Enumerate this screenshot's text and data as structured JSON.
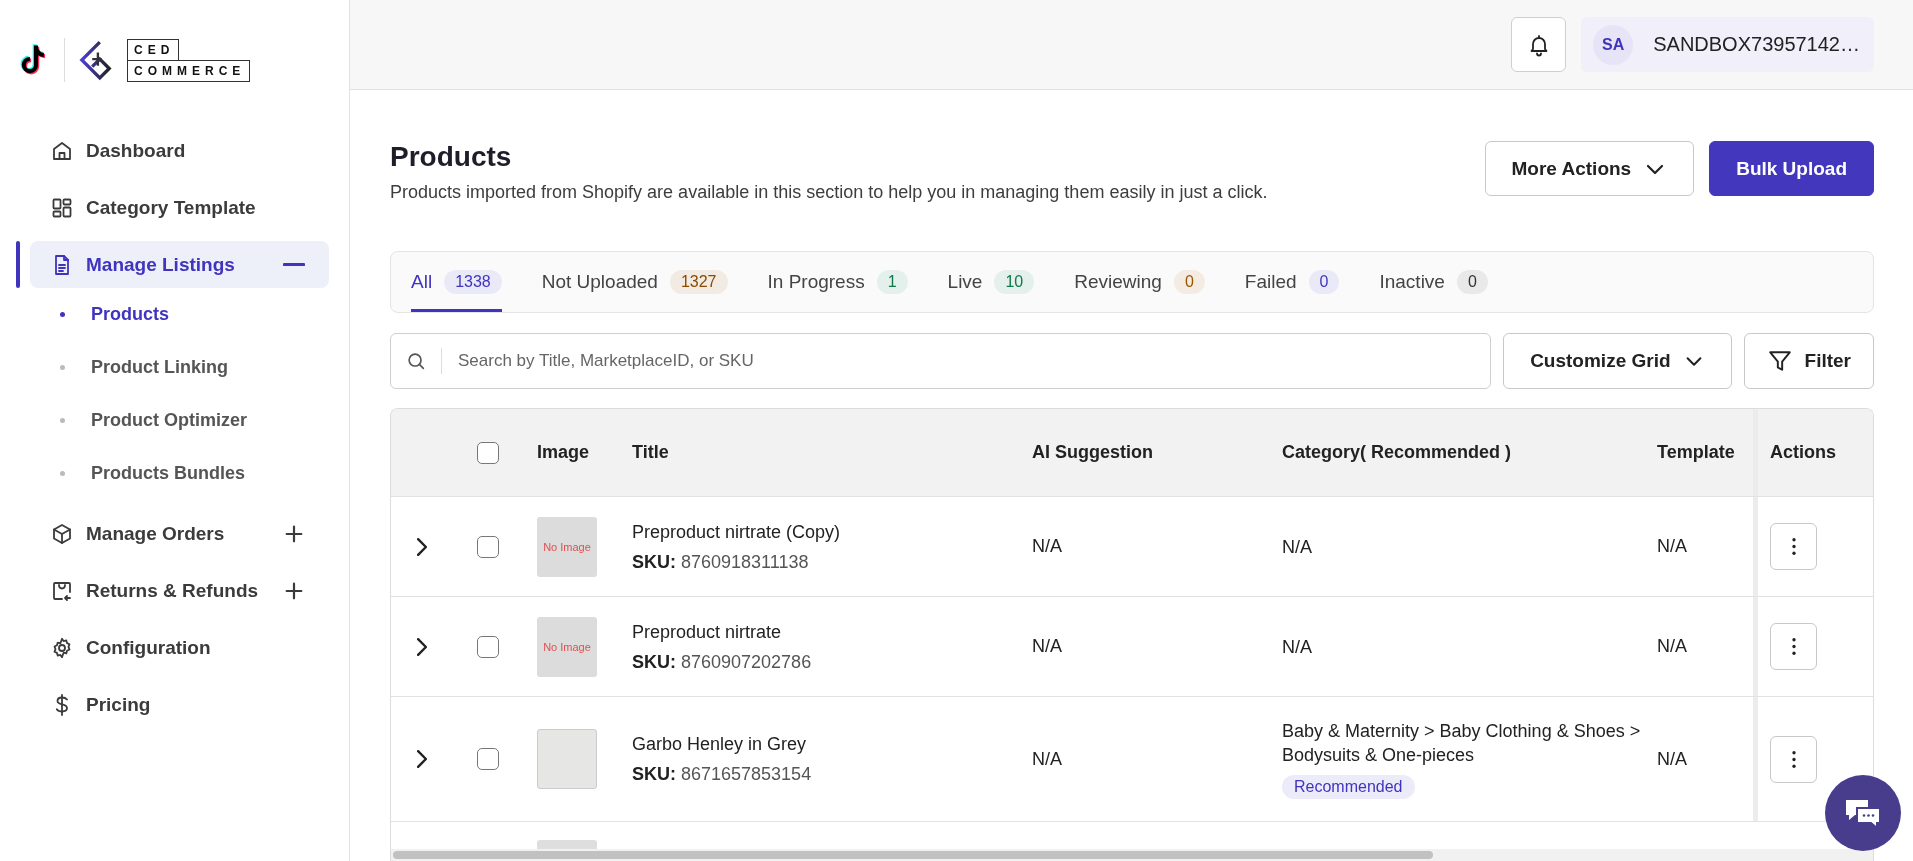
{
  "brand": {
    "logo_top": "CED",
    "logo_bottom": "COMMERCE"
  },
  "header": {
    "avatar_initials": "SA",
    "account_name": "SANDBOX73957142…"
  },
  "sidebar": {
    "items": [
      {
        "label": "Dashboard",
        "selected": false
      },
      {
        "label": "Category Template",
        "selected": false
      },
      {
        "label": "Manage Listings",
        "selected": true,
        "expanded": true,
        "children": [
          {
            "label": "Products",
            "selected": true
          },
          {
            "label": "Product Linking",
            "selected": false
          },
          {
            "label": "Product Optimizer",
            "selected": false
          },
          {
            "label": "Products Bundles",
            "selected": false
          }
        ]
      },
      {
        "label": "Manage Orders",
        "selected": false,
        "expanded": false
      },
      {
        "label": "Returns & Refunds",
        "selected": false,
        "expanded": false
      },
      {
        "label": "Configuration",
        "selected": false
      },
      {
        "label": "Pricing",
        "selected": false
      }
    ]
  },
  "page": {
    "title": "Products",
    "description": "Products imported from Shopify are available in this section to help you in managing them easily in just a click.",
    "buttons": [
      {
        "label": "More Actions",
        "kind": "dropdown"
      },
      {
        "label": "Bulk Upload",
        "kind": "primary"
      }
    ]
  },
  "tabs": [
    {
      "label": "All",
      "count": "1338",
      "color": "#4034be",
      "selected": true
    },
    {
      "label": "Not Uploaded",
      "count": "1327",
      "color": "#8a4a00",
      "selected": false
    },
    {
      "label": "In Progress",
      "count": "1",
      "color": "#0d7a48",
      "selected": false
    },
    {
      "label": "Live",
      "count": "10",
      "color": "#0d7a48",
      "selected": false
    },
    {
      "label": "Reviewing",
      "count": "0",
      "color": "#9a5500",
      "selected": false
    },
    {
      "label": "Failed",
      "count": "0",
      "color": "#4034be",
      "selected": false
    },
    {
      "label": "Inactive",
      "count": "0",
      "color": "#333333",
      "selected": false
    }
  ],
  "toolbar": {
    "search_placeholder": "Search by Title, MarketplaceID, or SKU",
    "buttons": [
      {
        "label": "Customize Grid",
        "kind": "dropdown"
      },
      {
        "label": "Filter",
        "kind": "filter"
      }
    ]
  },
  "table": {
    "select_all_checked": false,
    "columns": [
      "Image",
      "Title",
      "AI Suggestion",
      "Category( Recommended )",
      "Template",
      "Actions"
    ],
    "rows": [
      {
        "kind": "no_image",
        "expanded": false,
        "checked": false,
        "image_text": "No Image",
        "title": "Preproduct nirtrate (Copy)",
        "sku_label": "SKU:",
        "sku": "8760918311138",
        "ai_suggestion": "N/A",
        "category": "N/A",
        "template": "N/A"
      },
      {
        "kind": "no_image",
        "expanded": false,
        "checked": false,
        "image_text": "No Image",
        "title": "Preproduct nirtrate",
        "sku_label": "SKU:",
        "sku": "8760907202786",
        "ai_suggestion": "N/A",
        "category": "N/A",
        "template": "N/A"
      },
      {
        "kind": "photo",
        "expanded": false,
        "checked": false,
        "title": "Garbo Henley in Grey",
        "sku_label": "SKU:",
        "sku": "8671657853154",
        "ai_suggestion": "N/A",
        "category": "Baby & Maternity > Baby Clothing & Shoes > Bodysuits & One-pieces",
        "category_badge": "Recommended",
        "template": "N/A"
      },
      {
        "kind": "partial"
      }
    ]
  }
}
